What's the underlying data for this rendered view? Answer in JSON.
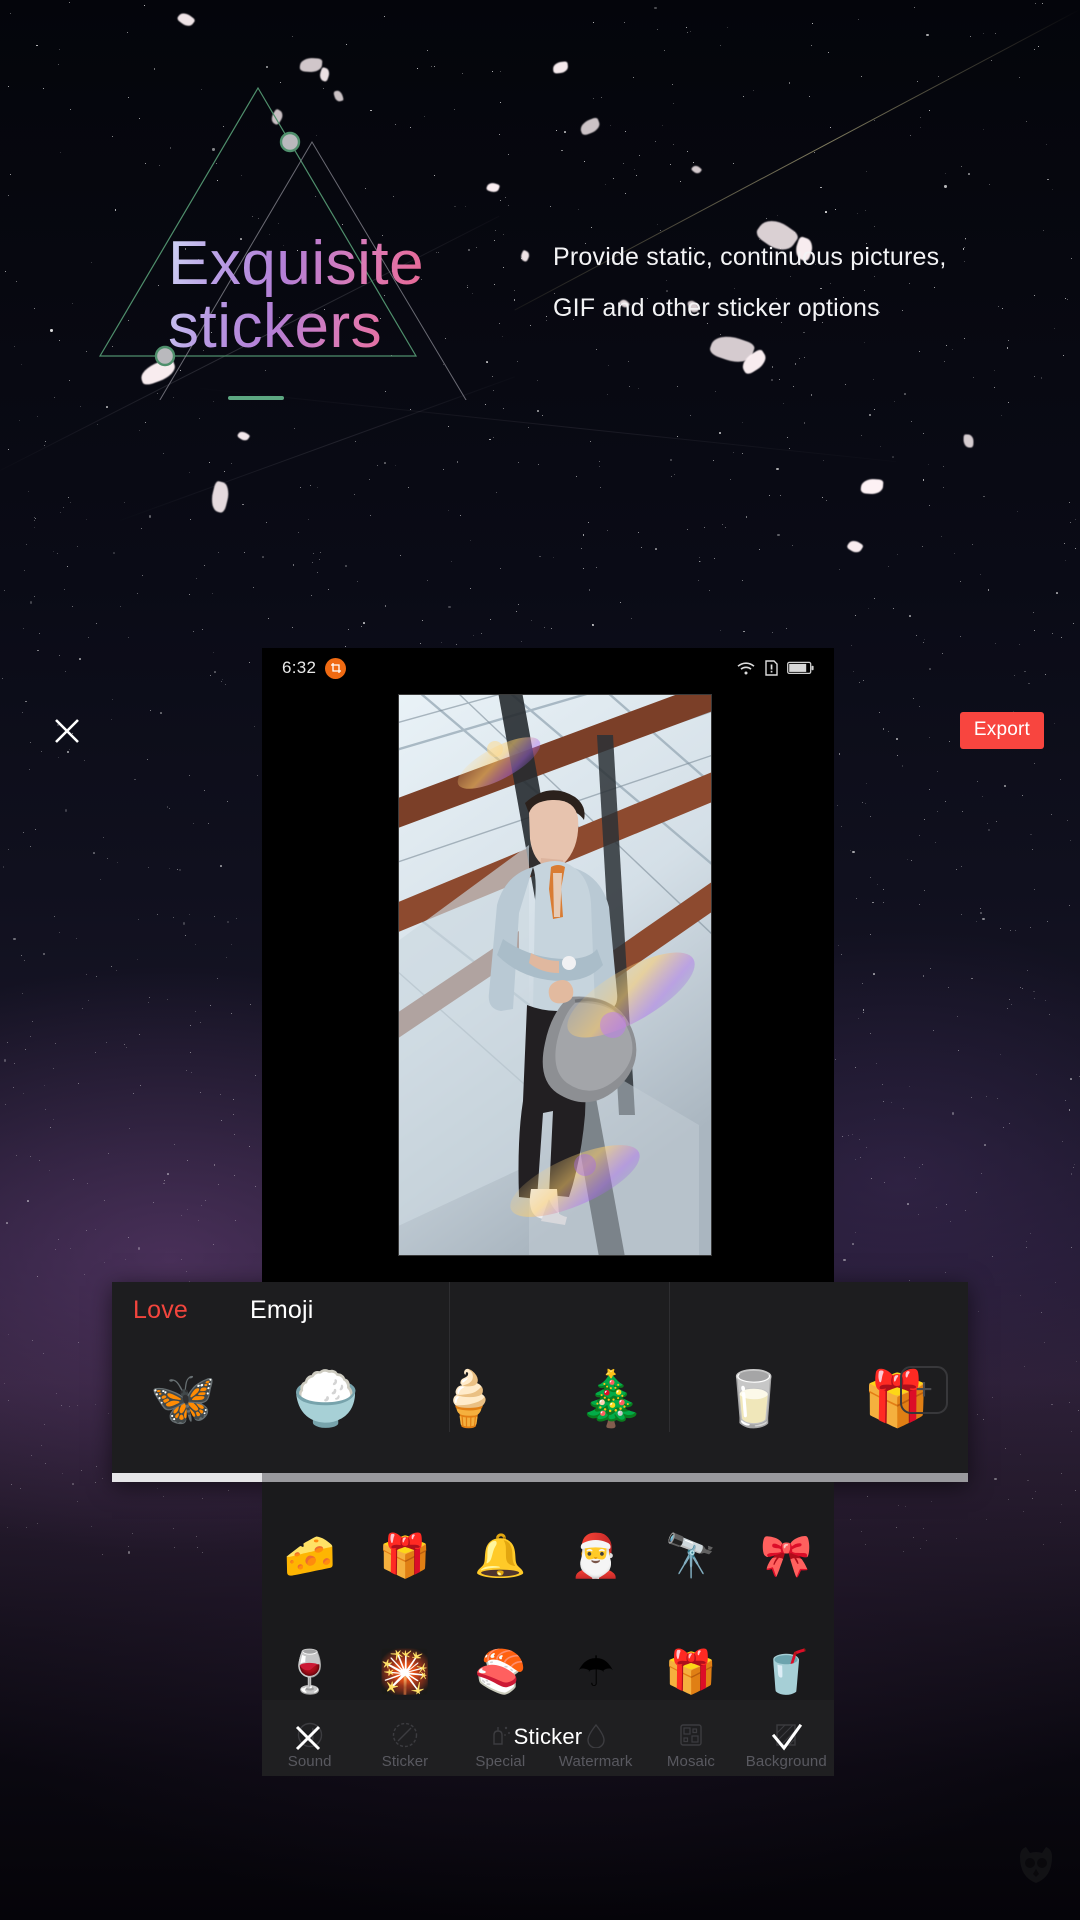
{
  "hero": {
    "title_line1": "Exquisite",
    "title_line2": "stickers",
    "description": "Provide static, continuous pictures, GIF and other sticker options",
    "accent_gradient_start": "#cfd6f5",
    "accent_gradient_end": "#f06a4e",
    "rule_color": "#5da882",
    "triangle_green": "#4f8f6c",
    "triangle_gray": "#8c8c95"
  },
  "phone": {
    "statusbar": {
      "time": "6:32",
      "app_badge_icon": "crop-icon",
      "wifi_icon": "wifi-icon",
      "sim_icon": "sim-alert-icon",
      "battery_icon": "battery-icon"
    },
    "close_icon": "close-icon",
    "export_label": "Export",
    "export_color": "#f8453f",
    "photo_alt": "young-man-denim-jacket-on-glass-staircase"
  },
  "sticker_panel": {
    "tabs": [
      {
        "label": "Love",
        "selected": true,
        "color": "#f2453d"
      },
      {
        "label": "Emoji",
        "selected": false,
        "color": "#ffffff"
      }
    ],
    "stickers": [
      {
        "name": "butterfly-sticker",
        "glyph": "🦋"
      },
      {
        "name": "rice-bowl-sticker",
        "glyph": "🍚"
      },
      {
        "name": "ice-cream-sticker",
        "glyph": "🍦"
      },
      {
        "name": "wreath-sticker",
        "glyph": "🎄"
      },
      {
        "name": "milk-carton-sticker",
        "glyph": "🥛"
      },
      {
        "name": "gift-sticker",
        "glyph": "🎁"
      }
    ],
    "add_button_label": "+",
    "scrollbar": {
      "position": 0,
      "thumb_fraction": 0.175
    }
  },
  "emoji_grid": {
    "rows": [
      [
        {
          "name": "cheese-emoji",
          "glyph": "🧀"
        },
        {
          "name": "gift-teal-emoji",
          "glyph": "🎁"
        },
        {
          "name": "bell-emoji",
          "glyph": "🔔"
        },
        {
          "name": "santa-emoji",
          "glyph": "🎅"
        },
        {
          "name": "binoculars-emoji",
          "glyph": "🔭"
        },
        {
          "name": "gift-pink-emoji",
          "glyph": "🎀"
        }
      ],
      [
        {
          "name": "wine-emoji",
          "glyph": "🍷"
        },
        {
          "name": "sparkler-emoji",
          "glyph": "🎇"
        },
        {
          "name": "sushi-emoji",
          "glyph": "🍣"
        },
        {
          "name": "umbrella-emoji",
          "glyph": "☂"
        },
        {
          "name": "gift-gold-emoji",
          "glyph": "🎁"
        },
        {
          "name": "cocktail-emoji",
          "glyph": "🥤"
        }
      ]
    ]
  },
  "bottom_toolbar": {
    "items": [
      {
        "label": "Sound",
        "icon": "music-note-icon"
      },
      {
        "label": "Sticker",
        "icon": "sticker-icon"
      },
      {
        "label": "Special",
        "icon": "magic-spray-icon"
      },
      {
        "label": "Watermark",
        "icon": "droplet-icon"
      },
      {
        "label": "Mosaic",
        "icon": "mosaic-grid-icon"
      },
      {
        "label": "Background",
        "icon": "hatched-square-icon"
      }
    ],
    "overlay": {
      "cancel_icon": "close-icon",
      "title": "Sticker",
      "confirm_icon": "check-icon"
    }
  },
  "watermark": {
    "name": "owl-logo-watermark"
  }
}
